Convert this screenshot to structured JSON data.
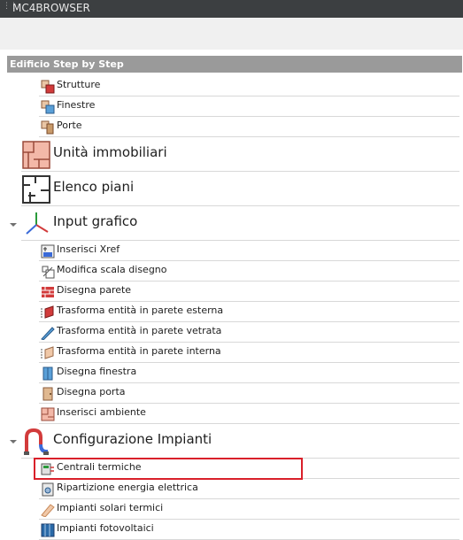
{
  "window": {
    "title": "MC4BROWSER"
  },
  "section": {
    "title": "Edificio Step by Step"
  },
  "items": [
    {
      "label": "Strutture"
    },
    {
      "label": "Finestre"
    },
    {
      "label": "Porte"
    },
    {
      "label": "Unità immobiliari"
    },
    {
      "label": "Elenco piani"
    },
    {
      "label": "Input grafico"
    },
    {
      "label": "Inserisci Xref"
    },
    {
      "label": "Modifica scala disegno"
    },
    {
      "label": "Disegna parete"
    },
    {
      "label": "Trasforma entità in parete esterna"
    },
    {
      "label": "Trasforma entità in parete vetrata"
    },
    {
      "label": "Trasforma entità in parete interna"
    },
    {
      "label": "Disegna finestra"
    },
    {
      "label": "Disegna porta"
    },
    {
      "label": "Inserisci ambiente"
    },
    {
      "label": "Configurazione Impianti"
    },
    {
      "label": "Centrali termiche"
    },
    {
      "label": "Ripartizione energia elettrica"
    },
    {
      "label": "Impianti solari termici"
    },
    {
      "label": "Impianti fotovoltaici"
    }
  ],
  "highlight_color": "#d9202a"
}
